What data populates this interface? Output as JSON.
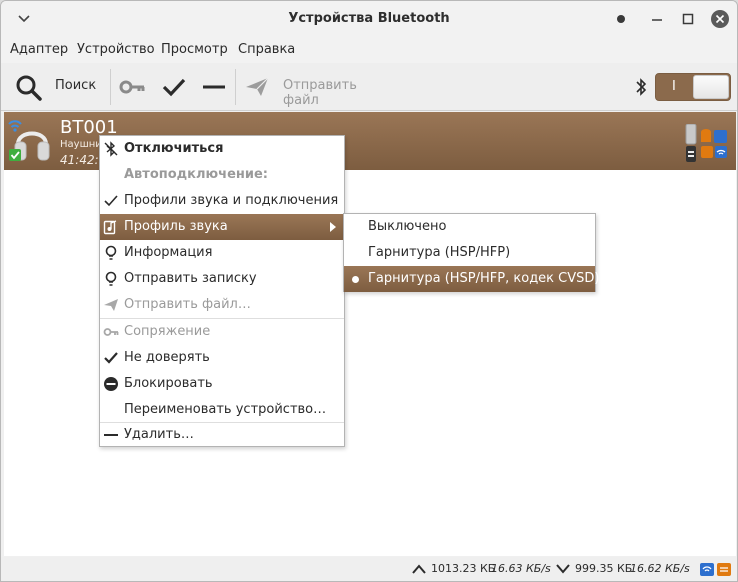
{
  "window": {
    "title": "Устройства Bluetooth"
  },
  "menubar": {
    "items": [
      "Адаптер",
      "Устройство",
      "Просмотр",
      "Справка"
    ]
  },
  "toolbar": {
    "search_label": "Поиск",
    "send_file_label": "Отправить файл",
    "switch_label": "I"
  },
  "device": {
    "name": "BT001",
    "subtitle": "Наушни",
    "time": "41:42:"
  },
  "context_menu": {
    "items": [
      {
        "label": "Отключиться",
        "icon": "bluetooth-off-icon",
        "bold": true
      },
      {
        "label": "Автоподключение:",
        "disabled": true,
        "bold": true
      },
      {
        "label": "Профили звука и подключения",
        "icon": "check-icon"
      },
      {
        "label": "Профиль звука",
        "icon": "audio-profile-icon",
        "highlighted": true,
        "submenu": true
      },
      {
        "label": "Информация",
        "icon": "lightbulb-icon"
      },
      {
        "label": "Отправить записку",
        "icon": "lightbulb-icon"
      },
      {
        "label": "Отправить файл…",
        "icon": "send-icon",
        "disabled": true
      },
      {
        "label": "Сопряжение",
        "icon": "key-icon",
        "disabled": true
      },
      {
        "label": "Не доверять",
        "icon": "check-icon"
      },
      {
        "label": "Блокировать",
        "icon": "block-icon"
      },
      {
        "label": "Переименовать устройство…"
      },
      {
        "label": "Удалить…",
        "icon": "minus-icon"
      }
    ]
  },
  "submenu": {
    "items": [
      {
        "label": "Выключено"
      },
      {
        "label": "Гарнитура (HSP/HFP)"
      },
      {
        "label": "Гарнитура (HSP/HFP, кодек CVSD)",
        "selected": true
      }
    ]
  },
  "statusbar": {
    "upload_total": "1013.23 КБ",
    "upload_rate": "16.63 КБ/s",
    "download_total": "999.35 КБ",
    "download_rate": "16.62 КБ/s"
  },
  "colors": {
    "accent": "#8b6a4c",
    "accent_dark": "#7d5d40"
  }
}
